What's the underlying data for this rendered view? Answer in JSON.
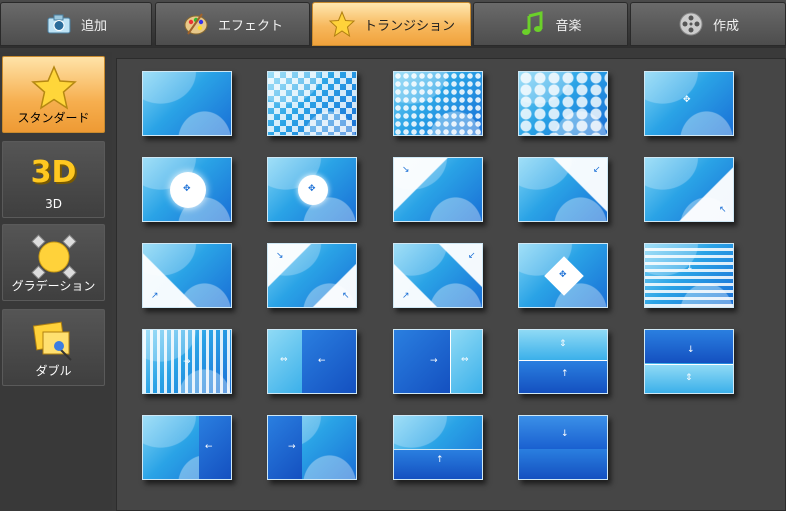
{
  "tabs": [
    {
      "label": "追加",
      "icon": "camera-icon"
    },
    {
      "label": "エフェクト",
      "icon": "palette-icon"
    },
    {
      "label": "トランジション",
      "icon": "star-icon"
    },
    {
      "label": "音楽",
      "icon": "music-note-icon"
    },
    {
      "label": "作成",
      "icon": "film-reel-icon"
    }
  ],
  "sidebar": {
    "items": [
      {
        "label": "スタンダード",
        "icon": "star-icon",
        "active": true
      },
      {
        "label": "3D",
        "icon": "3d-text-icon",
        "glyph": "3D"
      },
      {
        "label": "グラデーション",
        "icon": "gradient-sphere-icon"
      },
      {
        "label": "ダブル",
        "icon": "double-pin-icon"
      }
    ]
  },
  "transitions": {
    "count": 24
  },
  "colors": {
    "accent": "#f7b85d",
    "thumb_blue": "#2aa3e6"
  }
}
